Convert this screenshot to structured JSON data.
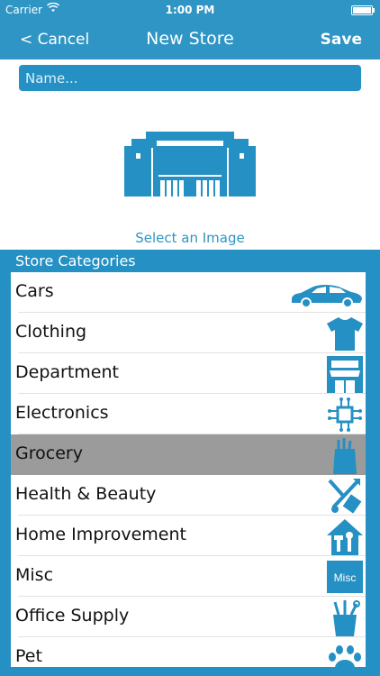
{
  "status_bar": {
    "carrier": "Carrier",
    "time": "1:00 PM"
  },
  "nav": {
    "cancel_label": "< Cancel",
    "title": "New Store",
    "save_label": "Save"
  },
  "form": {
    "name_placeholder": "Name...",
    "name_value": ""
  },
  "image_picker": {
    "label": "Select an Image",
    "icon": "store-building-icon"
  },
  "categories": {
    "header": "Store Categories",
    "selected": "Grocery",
    "items": [
      {
        "label": "Cars",
        "icon": "car-icon"
      },
      {
        "label": "Clothing",
        "icon": "tshirt-icon"
      },
      {
        "label": "Department",
        "icon": "department-store-icon"
      },
      {
        "label": "Electronics",
        "icon": "circuit-chip-icon"
      },
      {
        "label": "Grocery",
        "icon": "grocery-bag-icon"
      },
      {
        "label": "Health & Beauty",
        "icon": "health-beauty-icon"
      },
      {
        "label": "Home Improvement",
        "icon": "home-tools-icon"
      },
      {
        "label": "Misc",
        "icon": "misc-badge-icon",
        "badge_text": "Misc"
      },
      {
        "label": "Office Supply",
        "icon": "pencil-cup-icon"
      },
      {
        "label": "Pet",
        "icon": "paw-icon"
      }
    ]
  },
  "colors": {
    "primary": "#2e95c5",
    "panel": "#2590c3",
    "selected_row": "#9b9b9b"
  }
}
